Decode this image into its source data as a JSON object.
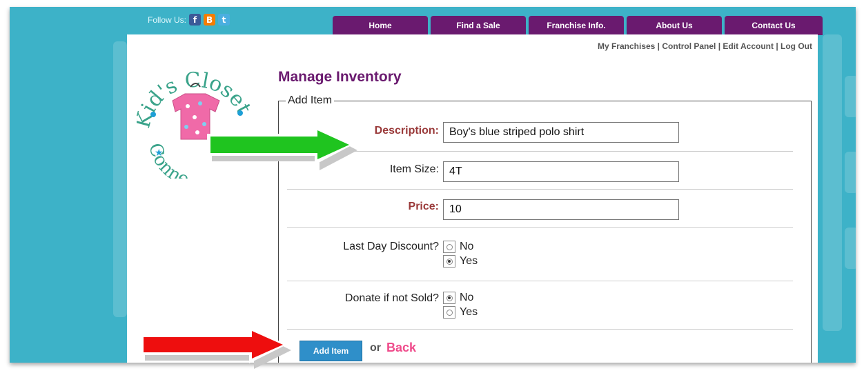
{
  "header": {
    "follow_label": "Follow Us:",
    "social": [
      {
        "icon": "facebook-icon",
        "glyph": "f",
        "color": "#3b5998"
      },
      {
        "icon": "blogger-icon",
        "glyph": "B",
        "color": "#f57d00"
      },
      {
        "icon": "twitter-icon",
        "glyph": "t",
        "color": "#4aaee0"
      }
    ],
    "nav": [
      "Home",
      "Find a Sale",
      "Franchise Info.",
      "About Us",
      "Contact Us"
    ],
    "nav_color": "#6a1a6f"
  },
  "account_links": [
    "My Franchises",
    "Control Panel",
    "Edit Account",
    "Log Out"
  ],
  "logo": {
    "top_text": "Kid's Closet",
    "bottom_text": "Conne"
  },
  "page_title": "Manage Inventory",
  "form": {
    "legend": "Add Item",
    "description": {
      "label": "Description:",
      "value": "Boy's blue striped polo shirt"
    },
    "item_size": {
      "label": "Item Size:",
      "value": "4T"
    },
    "price": {
      "label": "Price:",
      "value": "10"
    },
    "last_day_discount": {
      "label": "Last Day Discount?",
      "options": [
        "No",
        "Yes"
      ],
      "selected": "Yes"
    },
    "donate_if_not_sold": {
      "label": "Donate if not Sold?",
      "options": [
        "No",
        "Yes"
      ],
      "selected": "No"
    },
    "submit_label": "Add Item",
    "or_text": "or",
    "back_label": "Back"
  },
  "colors": {
    "background": "#3db2c8",
    "required_label": "#9a3a3a",
    "button": "#2f8fc9",
    "back_link": "#ef4b8b",
    "annotation_green": "#1fc41f",
    "annotation_red": "#ee0e0e"
  }
}
